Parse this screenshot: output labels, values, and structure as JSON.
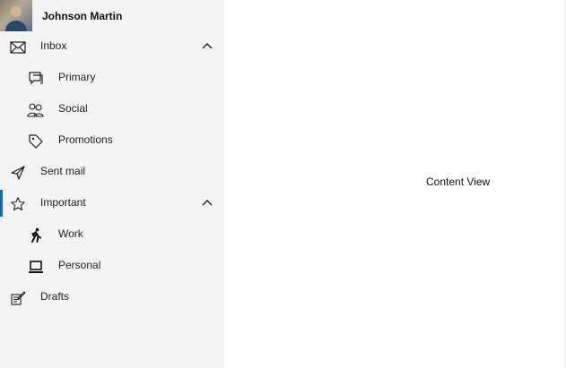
{
  "profile": {
    "name": "Johnson Martin"
  },
  "nav": {
    "inbox": {
      "label": "Inbox",
      "icon": "mail-icon",
      "expanded": true
    },
    "primary": {
      "label": "Primary",
      "icon": "chat-icon"
    },
    "social": {
      "label": "Social",
      "icon": "people-icon"
    },
    "promotions": {
      "label": "Promotions",
      "icon": "tag-icon"
    },
    "sent_mail": {
      "label": "Sent mail",
      "icon": "send-icon"
    },
    "important": {
      "label": "Important",
      "icon": "star-icon",
      "expanded": true,
      "selected": true
    },
    "work": {
      "label": "Work",
      "icon": "walking-person-icon"
    },
    "personal": {
      "label": "Personal",
      "icon": "laptop-icon"
    },
    "drafts": {
      "label": "Drafts",
      "icon": "compose-icon"
    }
  },
  "content": {
    "label": "Content View"
  },
  "colors": {
    "sidebar_background": "#f3f3f3",
    "selection_accent": "#0f6cbd",
    "content_background": "#ffffff"
  }
}
